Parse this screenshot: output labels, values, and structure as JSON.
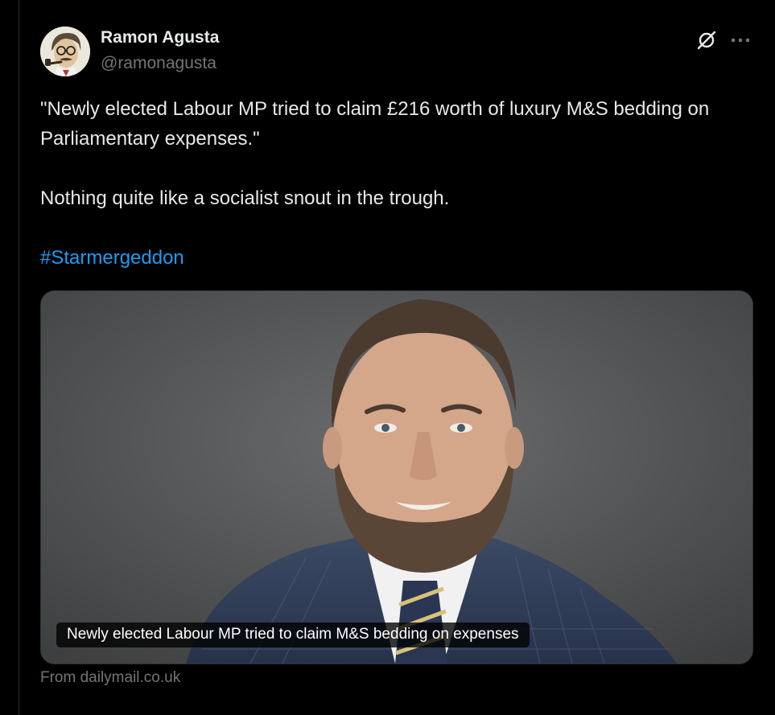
{
  "tweet": {
    "author": {
      "display_name": "Ramon Agusta",
      "handle": "@ramonagusta"
    },
    "header_actions": {
      "grok_icon": "grok-icon",
      "more_icon": "more-horizontal-icon"
    },
    "text": {
      "paragraph_1": "\"Newly elected Labour MP tried to claim £216 worth of luxury M&S bedding on Parliamentary expenses.\"",
      "paragraph_2": "Nothing quite like a socialist snout in the trough.",
      "hashtag": "#Starmergeddon"
    },
    "card": {
      "title": "Newly elected Labour MP tried to claim M&S bedding on expenses",
      "source": "From dailymail.co.uk"
    }
  },
  "colors": {
    "background": "#000000",
    "text": "#e7e9ea",
    "secondary_text": "#71767b",
    "link": "#1d9bf0",
    "border": "#2f3336"
  }
}
